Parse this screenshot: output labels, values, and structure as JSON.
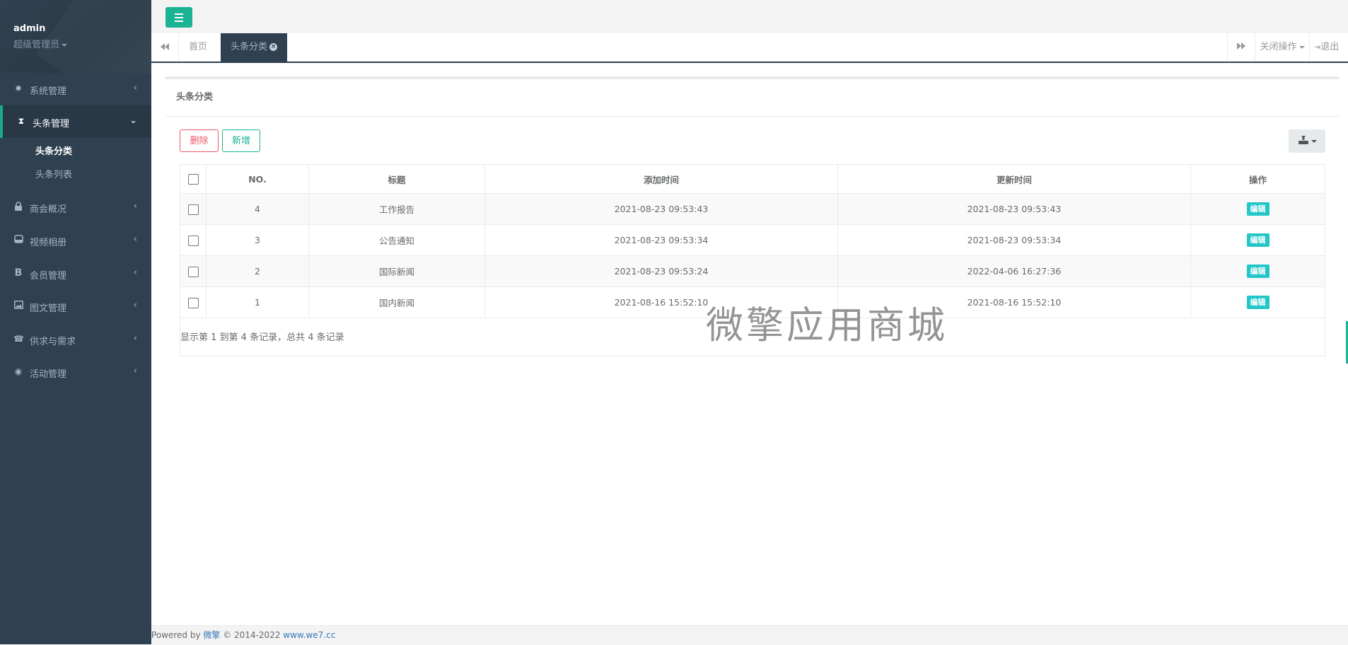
{
  "user": {
    "name": "admin",
    "role": "超级管理员"
  },
  "sidebar": {
    "items": [
      {
        "label": "系统管理",
        "icon": "gear-icon",
        "glyph": "✹"
      },
      {
        "label": "头条管理",
        "icon": "hourglass-icon",
        "glyph": "⧗"
      },
      {
        "label": "商会概况",
        "icon": "lock-icon",
        "glyph": "🔒"
      },
      {
        "label": "视频相册",
        "icon": "hdd-icon",
        "glyph": "▭"
      },
      {
        "label": "会员管理",
        "icon": "bold-icon",
        "glyph": "B"
      },
      {
        "label": "图文管理",
        "icon": "picture-icon",
        "glyph": "▣"
      },
      {
        "label": "供求与需求",
        "icon": "phone-icon",
        "glyph": "☎"
      },
      {
        "label": "活动管理",
        "icon": "soccer-ball-icon",
        "glyph": "◉"
      }
    ],
    "subitems": [
      {
        "label": "头条分类"
      },
      {
        "label": "头条列表"
      }
    ]
  },
  "tabs": {
    "home": "首页",
    "active": "头条分类",
    "close_ops": "关闭操作",
    "logout": "退出"
  },
  "panel": {
    "title": "头条分类"
  },
  "toolbar": {
    "delete": "删除",
    "add": "新增"
  },
  "table": {
    "headers": [
      "NO.",
      "标题",
      "添加时间",
      "更新时间",
      "操作"
    ],
    "rows": [
      {
        "no": "4",
        "title": "工作报告",
        "added": "2021-08-23 09:53:43",
        "updated": "2021-08-23 09:53:43",
        "action": "编辑"
      },
      {
        "no": "3",
        "title": "公告通知",
        "added": "2021-08-23 09:53:34",
        "updated": "2021-08-23 09:53:34",
        "action": "编辑"
      },
      {
        "no": "2",
        "title": "国际新闻",
        "added": "2021-08-23 09:53:24",
        "updated": "2022-04-06 16:27:36",
        "action": "编辑"
      },
      {
        "no": "1",
        "title": "国内新闻",
        "added": "2021-08-16 15:52:10",
        "updated": "2021-08-16 15:52:10",
        "action": "编辑"
      }
    ],
    "summary": "显示第 1 到第 4 条记录，总共 4 条记录"
  },
  "watermark": "微擎应用商城",
  "footer": {
    "powered": "Powered by",
    "brand": "微擎",
    "copyright": "© 2014-2022",
    "link": "www.we7.cc"
  },
  "colors": {
    "sidebar": "#2f4050",
    "accent": "#1ab394",
    "danger": "#ed5565",
    "info": "#23c6c8"
  }
}
